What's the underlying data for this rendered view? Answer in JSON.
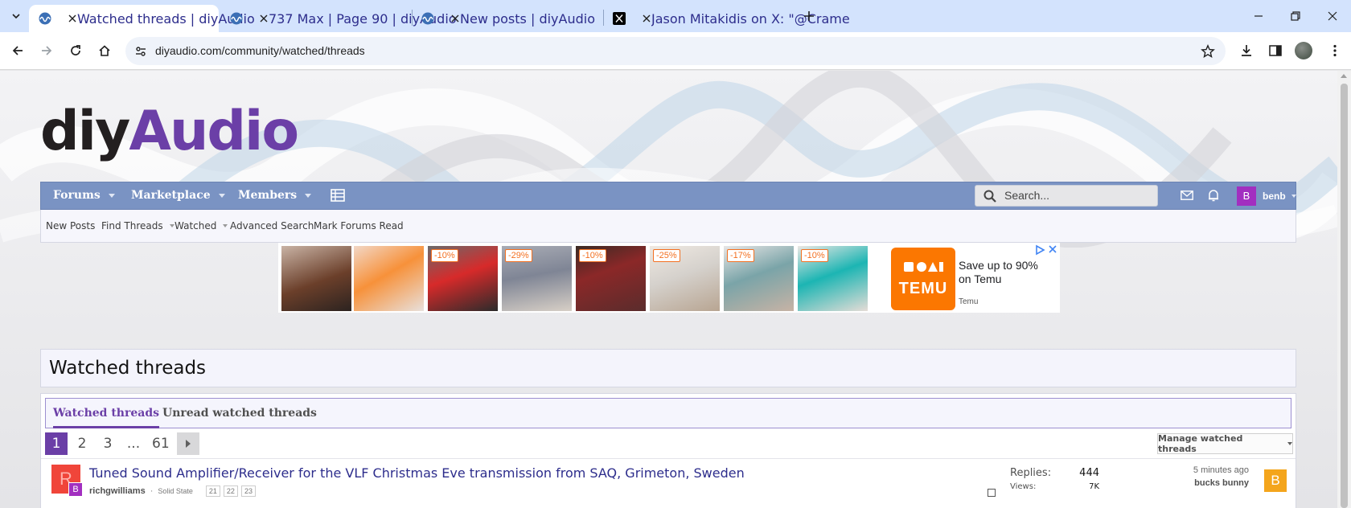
{
  "browser": {
    "tabs": [
      {
        "title": "Watched threads | diyAudio",
        "active": true,
        "favicon": "diyaudio-wave-icon"
      },
      {
        "title": "737 Max | Page 90 | diyAudio",
        "active": false,
        "favicon": "diyaudio-wave-icon"
      },
      {
        "title": "New posts | diyAudio",
        "active": false,
        "favicon": "diyaudio-wave-icon"
      },
      {
        "title": "Jason Mitakidis on X: \"@Crame",
        "active": false,
        "favicon": "x-logo-icon"
      }
    ],
    "url": "diyaudio.com/community/watched/threads"
  },
  "site": {
    "logo_part1": "diy",
    "logo_part2": "Audio",
    "brand_color": "#6b3fa7",
    "nav_color": "#7a93c3"
  },
  "mainnav": {
    "items": [
      "Forums",
      "Marketplace",
      "Members"
    ],
    "search_placeholder": "Search...",
    "user_initial": "B",
    "username": "benb"
  },
  "subnav": {
    "items": [
      {
        "label": "New Posts",
        "dropdown": false
      },
      {
        "label": "Find Threads",
        "dropdown": true
      },
      {
        "label": "Watched",
        "dropdown": true
      },
      {
        "label": "Advanced Search",
        "dropdown": false
      },
      {
        "label": "Mark Forums Read",
        "dropdown": false
      }
    ]
  },
  "ad": {
    "discounts": [
      "-10%",
      "-29%",
      "-10%",
      "-25%",
      "-17%",
      "-10%"
    ],
    "logo_text": "TEMU",
    "headline": "Save up to 90% on Temu",
    "brand": "Temu"
  },
  "page": {
    "title": "Watched threads",
    "tabs": [
      "Watched threads",
      "Unread watched threads"
    ],
    "pagination": [
      "1",
      "2",
      "3",
      "...",
      "61"
    ],
    "current_page": "1",
    "manage_label": "Manage watched threads"
  },
  "threads": [
    {
      "avatar_initial": "R",
      "avatar_color": "#f0453a",
      "mini_avatar_initial": "B",
      "title": "Tuned Sound Amplifier/Receiver for the VLF Christmas Eve transmission from SAQ, Grimeton, Sweden",
      "author": "richgwilliams",
      "forum": "Solid State",
      "pages": [
        "21",
        "22",
        "23"
      ],
      "replies_label": "Replies:",
      "replies": "444",
      "views_label": "Views:",
      "views": "7K",
      "last_time": "5 minutes ago",
      "last_user": "bucks bunny",
      "last_avatar_initial": "B",
      "last_avatar_color": "#f4a51c"
    }
  ]
}
